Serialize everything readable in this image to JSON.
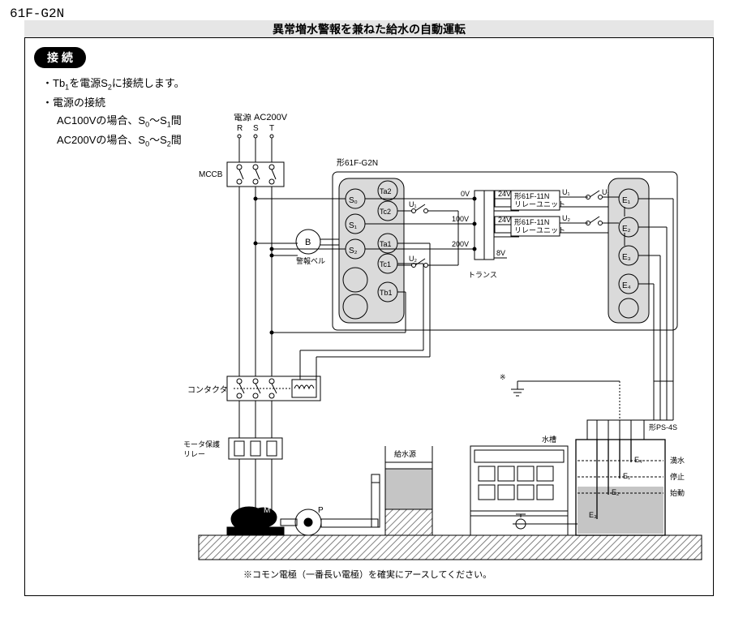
{
  "model_id": "61F-G2N",
  "title": "異常増水警報を兼ねた給水の自動運転",
  "section_label": "接  続",
  "instructions": {
    "line1_prefix": "・Tb",
    "line1_sub": "1",
    "line1_mid": "を電源S",
    "line1_sub2": "2",
    "line1_suffix": "に接続します。",
    "line2": "・電源の接続",
    "line3_prefix": "AC100Vの場合、S",
    "line3_sub1": "0",
    "line3_mid": "～S",
    "line3_sub2": "1",
    "line3_suffix": "間",
    "line4_prefix": "AC200Vの場合、S",
    "line4_sub1": "0",
    "line4_mid": "～S",
    "line4_sub2": "2",
    "line4_suffix": "間"
  },
  "labels": {
    "power": "電源 AC200V",
    "R": "R",
    "S": "S",
    "T": "T",
    "mccb": "MCCB",
    "main_unit": "形61F-G2N",
    "bell": "警報ベル",
    "B": "B",
    "S0": "S₀",
    "S1": "S₁",
    "S2": "S₂",
    "Ta1": "Ta1",
    "Ta2": "Ta2",
    "Tb1": "Tb1",
    "Tc1": "Tc1",
    "Tc2": "Tc2",
    "U1": "U₁",
    "U2": "U₂",
    "v0": "0V",
    "v100": "100V",
    "v200": "200V",
    "v8": "8V",
    "v24": "24V",
    "relay_unit_a": "形61F-11N",
    "relay_unit_b": "リレーユニット",
    "transformer": "トランス",
    "E1": "E₁",
    "E2": "E₂",
    "E3": "E₃",
    "E4": "E₄",
    "contactor": "コンタクタ",
    "motor_protect_a": "モータ保護",
    "motor_protect_b": "リレー",
    "M": "M",
    "P": "P",
    "supply_source": "給水源",
    "tank": "水槽",
    "ps4s": "形PS-4S",
    "full": "満水",
    "stop": "停止",
    "start": "始動",
    "ground_note": "※コモン電極（一番長い電極）を確実にアースしてください。"
  }
}
